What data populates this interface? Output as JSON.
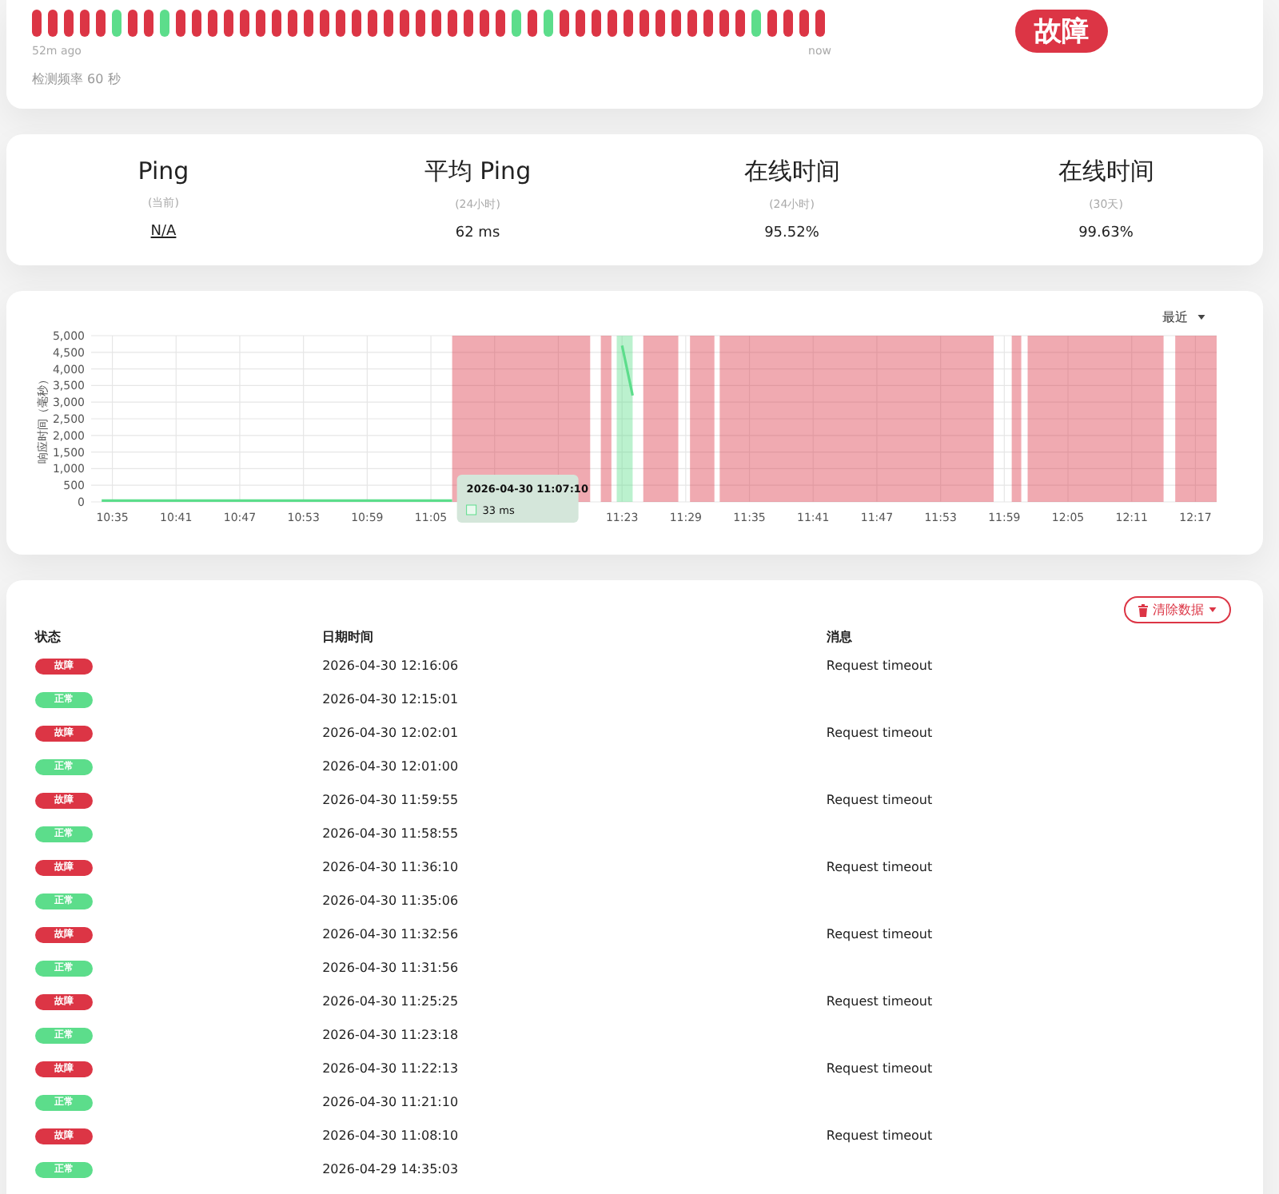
{
  "heartbeat": {
    "beats": [
      {
        "color": "#dc3545"
      },
      {
        "color": "#dc3545"
      },
      {
        "color": "#dc3545"
      },
      {
        "color": "#dc3545"
      },
      {
        "color": "#dc3545"
      },
      {
        "color": "#5cdd8b"
      },
      {
        "color": "#dc3545"
      },
      {
        "color": "#dc3545"
      },
      {
        "color": "#5cdd8b"
      },
      {
        "color": "#dc3545"
      },
      {
        "color": "#dc3545"
      },
      {
        "color": "#dc3545"
      },
      {
        "color": "#dc3545"
      },
      {
        "color": "#dc3545"
      },
      {
        "color": "#dc3545"
      },
      {
        "color": "#dc3545"
      },
      {
        "color": "#dc3545"
      },
      {
        "color": "#dc3545"
      },
      {
        "color": "#dc3545"
      },
      {
        "color": "#dc3545"
      },
      {
        "color": "#dc3545"
      },
      {
        "color": "#dc3545"
      },
      {
        "color": "#dc3545"
      },
      {
        "color": "#dc3545"
      },
      {
        "color": "#dc3545"
      },
      {
        "color": "#dc3545"
      },
      {
        "color": "#dc3545"
      },
      {
        "color": "#dc3545"
      },
      {
        "color": "#dc3545"
      },
      {
        "color": "#dc3545"
      },
      {
        "color": "#5cdd8b"
      },
      {
        "color": "#dc3545"
      },
      {
        "color": "#5cdd8b"
      },
      {
        "color": "#dc3545"
      },
      {
        "color": "#dc3545"
      },
      {
        "color": "#dc3545"
      },
      {
        "color": "#dc3545"
      },
      {
        "color": "#dc3545"
      },
      {
        "color": "#dc3545"
      },
      {
        "color": "#dc3545"
      },
      {
        "color": "#dc3545"
      },
      {
        "color": "#dc3545"
      },
      {
        "color": "#dc3545"
      },
      {
        "color": "#dc3545"
      },
      {
        "color": "#dc3545"
      },
      {
        "color": "#5cdd8b"
      },
      {
        "color": "#dc3545"
      },
      {
        "color": "#dc3545"
      },
      {
        "color": "#dc3545"
      },
      {
        "color": "#dc3545"
      }
    ],
    "start_label": "52m ago",
    "end_label": "now",
    "interval": "检测频率 60 秒",
    "status": {
      "label": "故障",
      "color": "#dc3545"
    }
  },
  "stats": [
    {
      "title": "Ping",
      "subtitle": "(当前)",
      "value": "N/A",
      "link": true
    },
    {
      "title": "平均 Ping",
      "subtitle": "(24小时)",
      "value": "62 ms",
      "link": false
    },
    {
      "title": "在线时间",
      "subtitle": "(24小时)",
      "value": "95.52%",
      "link": false
    },
    {
      "title": "在线时间",
      "subtitle": "(30天)",
      "value": "99.63%",
      "link": false
    }
  ],
  "chart": {
    "range": "最近",
    "tooltip": {
      "title": "2026-04-30 11:07:10",
      "value": "33 ms"
    },
    "chart_data": {
      "type": "line",
      "ylabel": "响应时间（毫秒）",
      "ylim": [
        0,
        5000
      ],
      "grid": true,
      "yticks": [
        {
          "value": 0,
          "label": "0"
        },
        {
          "value": 500,
          "label": "500"
        },
        {
          "value": 1000,
          "label": "1,000"
        },
        {
          "value": 1500,
          "label": "1,500"
        },
        {
          "value": 2000,
          "label": "2,000"
        },
        {
          "value": 2500,
          "label": "2,500"
        },
        {
          "value": 3000,
          "label": "3,000"
        },
        {
          "value": 3500,
          "label": "3,500"
        },
        {
          "value": 4000,
          "label": "4,000"
        },
        {
          "value": 4500,
          "label": "4,500"
        },
        {
          "value": 5000,
          "label": "5,000"
        }
      ],
      "xlim": [
        633,
        739
      ],
      "xticks": [
        {
          "value": 635,
          "label": "10:35"
        },
        {
          "value": 641,
          "label": "10:41"
        },
        {
          "value": 647,
          "label": "10:47"
        },
        {
          "value": 653,
          "label": "10:53"
        },
        {
          "value": 659,
          "label": "10:59"
        },
        {
          "value": 665,
          "label": "11:05"
        },
        {
          "value": 683,
          "label": "11:23"
        },
        {
          "value": 689,
          "label": "11:29"
        },
        {
          "value": 695,
          "label": "11:35"
        },
        {
          "value": 701,
          "label": "11:41"
        },
        {
          "value": 707,
          "label": "11:47"
        },
        {
          "value": 713,
          "label": "11:53"
        },
        {
          "value": 719,
          "label": "11:59"
        },
        {
          "value": 725,
          "label": "12:05"
        },
        {
          "value": 731,
          "label": "12:11"
        },
        {
          "value": 737,
          "label": "12:17"
        }
      ],
      "x": [
        634,
        640,
        646,
        652,
        658,
        664,
        667,
        683,
        684
      ],
      "series": [
        {
          "color": "#5cdd8b",
          "values": [
            40,
            40,
            40,
            40,
            40,
            40,
            40,
            null,
            null
          ]
        },
        {
          "color": "#5cdd8b",
          "values": [
            null,
            null,
            null,
            null,
            null,
            null,
            null,
            4700,
            3200
          ]
        }
      ],
      "bands": [
        {
          "axis": "x",
          "from": 667,
          "to": 680,
          "color": "#dc3545"
        },
        {
          "axis": "x",
          "from": 681,
          "to": 682,
          "color": "#dc3545"
        },
        {
          "axis": "x",
          "from": 682.5,
          "to": 684,
          "color": "#5cdd8b"
        },
        {
          "axis": "x",
          "from": 685,
          "to": 688.3,
          "color": "#dc3545"
        },
        {
          "axis": "x",
          "from": 689.4,
          "to": 691.7,
          "color": "#dc3545"
        },
        {
          "axis": "x",
          "from": 692.2,
          "to": 718,
          "color": "#dc3545"
        },
        {
          "axis": "x",
          "from": 719.7,
          "to": 720.6,
          "color": "#dc3545"
        },
        {
          "axis": "x",
          "from": 721.2,
          "to": 734,
          "color": "#dc3545"
        },
        {
          "axis": "x",
          "from": 735.1,
          "to": 739,
          "color": "#dc3545"
        }
      ]
    }
  },
  "events": {
    "clear_button": "清除数据",
    "columns": [
      "状态",
      "日期时间",
      "消息"
    ],
    "rows": [
      {
        "color": "#dc3545",
        "badge": "故障",
        "time": "2026-04-30 12:16:06",
        "message": "Request timeout"
      },
      {
        "color": "#5cdd8b",
        "badge": "正常",
        "time": "2026-04-30 12:15:01"
      },
      {
        "color": "#dc3545",
        "badge": "故障",
        "time": "2026-04-30 12:02:01",
        "message": "Request timeout"
      },
      {
        "color": "#5cdd8b",
        "badge": "正常",
        "time": "2026-04-30 12:01:00"
      },
      {
        "color": "#dc3545",
        "badge": "故障",
        "time": "2026-04-30 11:59:55",
        "message": "Request timeout"
      },
      {
        "color": "#5cdd8b",
        "badge": "正常",
        "time": "2026-04-30 11:58:55"
      },
      {
        "color": "#dc3545",
        "badge": "故障",
        "time": "2026-04-30 11:36:10",
        "message": "Request timeout"
      },
      {
        "color": "#5cdd8b",
        "badge": "正常",
        "time": "2026-04-30 11:35:06"
      },
      {
        "color": "#dc3545",
        "badge": "故障",
        "time": "2026-04-30 11:32:56",
        "message": "Request timeout"
      },
      {
        "color": "#5cdd8b",
        "badge": "正常",
        "time": "2026-04-30 11:31:56"
      },
      {
        "color": "#dc3545",
        "badge": "故障",
        "time": "2026-04-30 11:25:25",
        "message": "Request timeout"
      },
      {
        "color": "#5cdd8b",
        "badge": "正常",
        "time": "2026-04-30 11:23:18"
      },
      {
        "color": "#dc3545",
        "badge": "故障",
        "time": "2026-04-30 11:22:13",
        "message": "Request timeout"
      },
      {
        "color": "#5cdd8b",
        "badge": "正常",
        "time": "2026-04-30 11:21:10"
      },
      {
        "color": "#dc3545",
        "badge": "故障",
        "time": "2026-04-30 11:08:10",
        "message": "Request timeout"
      },
      {
        "color": "#5cdd8b",
        "badge": "正常",
        "time": "2026-04-29 14:35:03"
      }
    ]
  }
}
